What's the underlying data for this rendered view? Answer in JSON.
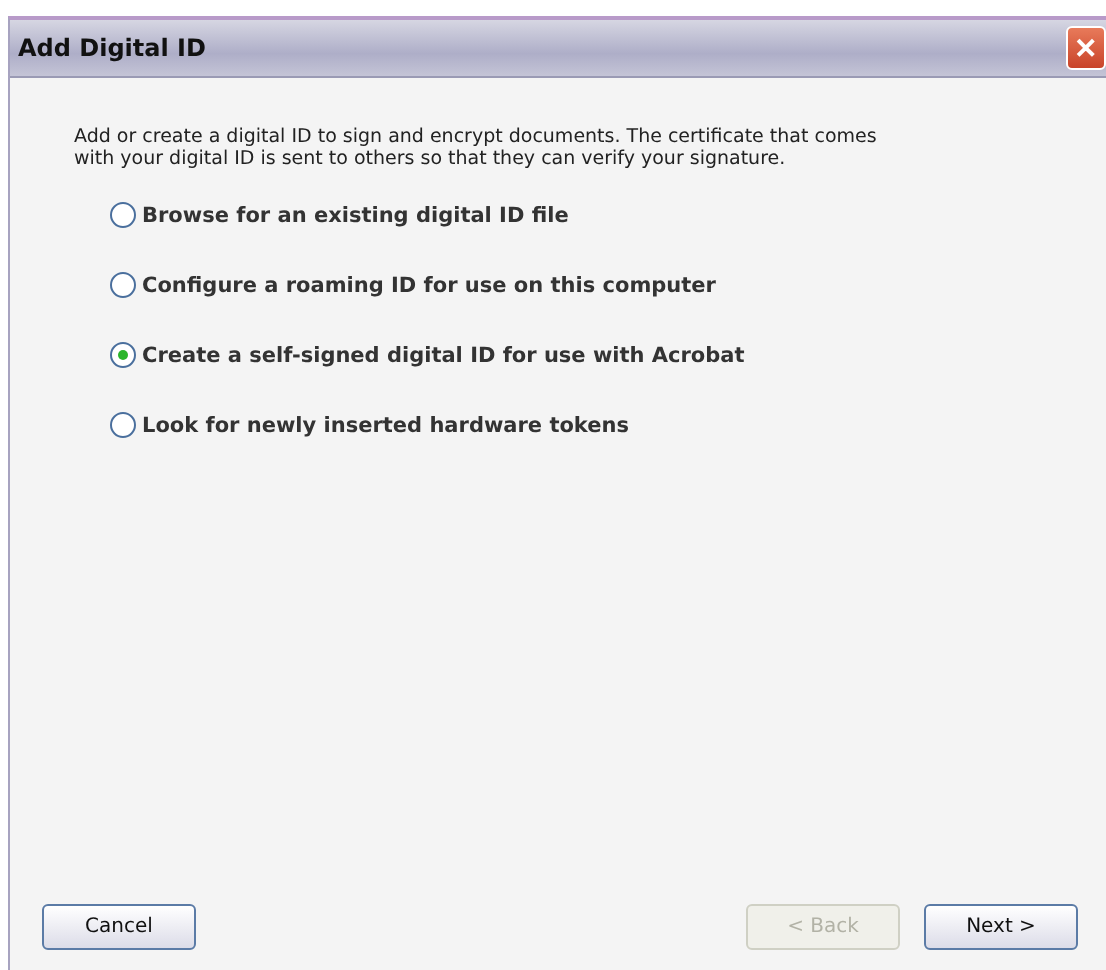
{
  "window": {
    "title": "Add Digital ID",
    "close": "✕"
  },
  "intro": "Add or create a digital ID to sign and encrypt documents. The certificate that comes with your digital ID is sent to others so that they can verify your signature.",
  "options": [
    {
      "label": "Browse for an existing digital ID file",
      "selected": false
    },
    {
      "label": "Configure a roaming ID for use on this computer",
      "selected": false
    },
    {
      "label": "Create a self-signed digital ID for use with Acrobat",
      "selected": true
    },
    {
      "label": "Look for newly inserted hardware tokens",
      "selected": false
    }
  ],
  "buttons": [
    {
      "label": "Cancel",
      "disabled": false,
      "kind": "left"
    },
    {
      "label": "< Back",
      "disabled": true,
      "kind": "right"
    },
    {
      "label": "Next >",
      "disabled": false,
      "kind": "right"
    }
  ]
}
